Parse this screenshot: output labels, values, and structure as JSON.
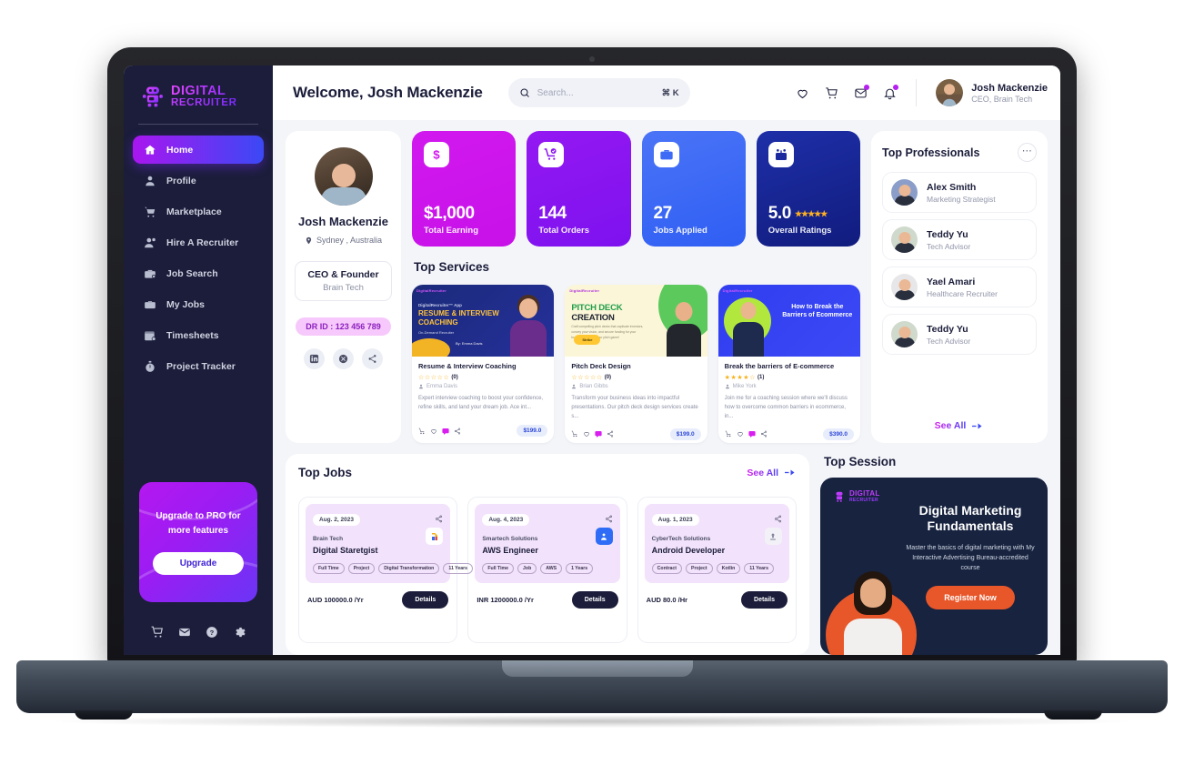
{
  "brand": {
    "line1": "DIGITAL",
    "line2": "RECRUITER",
    "icon": "robot-icon"
  },
  "sidebar": {
    "items": [
      {
        "label": "Home",
        "icon": "home-icon",
        "active": true
      },
      {
        "label": "Profile",
        "icon": "user-icon",
        "active": false
      },
      {
        "label": "Marketplace",
        "icon": "cart-icon",
        "active": false
      },
      {
        "label": "Hire A Recruiter",
        "icon": "user-plus-icon",
        "active": false
      },
      {
        "label": "Job Search",
        "icon": "briefcase-search-icon",
        "active": false
      },
      {
        "label": "My Jobs",
        "icon": "briefcase-icon",
        "active": false
      },
      {
        "label": "Timesheets",
        "icon": "calendar-clock-icon",
        "active": false
      },
      {
        "label": "Project Tracker",
        "icon": "stopwatch-icon",
        "active": false
      }
    ],
    "upgrade": {
      "text_pre": "Upgrade to ",
      "text_bold": "PRO",
      "text_post": " for more features",
      "button": "Upgrade"
    },
    "bottom_icons": [
      "cart-icon",
      "mail-icon",
      "help-icon",
      "settings-icon"
    ]
  },
  "header": {
    "welcome": "Welcome, Josh Mackenzie",
    "search": {
      "placeholder": "Search...",
      "value": "",
      "shortcut": "⌘ K",
      "icon": "search-icon"
    },
    "icons": [
      {
        "name": "heart-icon",
        "badge": false
      },
      {
        "name": "cart-icon",
        "badge": false
      },
      {
        "name": "mail-icon",
        "badge": true
      },
      {
        "name": "bell-icon",
        "badge": true
      }
    ],
    "user": {
      "name": "Josh Mackenzie",
      "role": "CEO, Brain Tech"
    }
  },
  "profile": {
    "name": "Josh Mackenzie",
    "location": "Sydney , Australia",
    "role_title": "CEO & Founder",
    "role_company": "Brain Tech",
    "dr_id": "DR ID : 123 456 789",
    "socials": [
      "linkedin-icon",
      "x-icon",
      "share-icon"
    ]
  },
  "stats": [
    {
      "value": "$1,000",
      "label": "Total Earning",
      "icon": "dollar-icon",
      "color": "#d119ef",
      "stars": ""
    },
    {
      "value": "144",
      "label": "Total Orders",
      "icon": "cart-check-icon",
      "color": "#8b15f0",
      "stars": ""
    },
    {
      "value": "27",
      "label": "Jobs Applied",
      "icon": "briefcase-icon",
      "color": "#3d6bf5",
      "stars": ""
    },
    {
      "value": "5.0",
      "label": "Overall Ratings",
      "icon": "badge-icon",
      "color": "#1a2a9e",
      "stars": "★★★★★"
    }
  ],
  "services": {
    "title": "Top Services",
    "items": [
      {
        "name": "Resume & Interview Coaching",
        "stars": "☆☆☆☆☆",
        "rating_count": "(0)",
        "author": "Emma Davis",
        "desc": "Expert interview coaching to boost your confidence, refine skills, and land your dream job. Ace int...",
        "price": "$199.0",
        "thumb": {
          "logo": "DigitalRecruiter",
          "kicker": "DigitalRecruiter™ App",
          "title": "RESUME & INTERVIEW COACHING",
          "sub": "On-Demand Recruiter",
          "by": "By: Emma Davis"
        }
      },
      {
        "name": "Pitch Deck Design",
        "stars": "☆☆☆☆☆",
        "rating_count": "(0)",
        "author": "Brian Gibbs",
        "desc": "Transform your business ideas into impactful presentations. Our pitch deck design services create s...",
        "price": "$199.0",
        "thumb": {
          "title_green": "PITCH DECK",
          "title_dark": "CREATION",
          "body": "Craft compelling pitch decks that captivate investors, convey your vision, and secure funding for your business. Elevate your pitch game!",
          "button": "Strike"
        }
      },
      {
        "name": "Break the barriers of E-commerce",
        "stars": "★★★★☆",
        "rating_count": "(1)",
        "author": "Mike York",
        "desc": "Join me for a coaching session where we'll discuss how to overcome common barriers in ecommerce, in...",
        "price": "$390.0",
        "thumb": {
          "headline": "How to Break the Barriers of Ecommerce"
        }
      }
    ],
    "footer_icons": [
      "cart-icon",
      "heart-icon",
      "chat-icon",
      "share-icon"
    ]
  },
  "professionals": {
    "title": "Top Professionals",
    "more_icon": "ellipsis-icon",
    "items": [
      {
        "name": "Alex Smith",
        "role": "Marketing Strategist",
        "avatar_bg": "#8b9ec9"
      },
      {
        "name": "Teddy Yu",
        "role": "Tech Advisor",
        "avatar_bg": "#cfd9cc"
      },
      {
        "name": "Yael Amari",
        "role": "Healthcare Recruiter",
        "avatar_bg": "#e7e7e9"
      },
      {
        "name": "Teddy Yu",
        "role": "Tech Advisor",
        "avatar_bg": "#cfd9cc"
      }
    ],
    "see_all": "See All"
  },
  "jobs": {
    "title": "Top Jobs",
    "see_all": "See All",
    "details_label": "Details",
    "items": [
      {
        "date": "Aug. 2, 2023",
        "company": "Brain Tech",
        "role": "Digital Staretgist",
        "tags": [
          "Full Time",
          "Project",
          "Digital Transformation",
          "11 Years"
        ],
        "salary": "AUD 100000.0 /Yr",
        "logo_style": "white",
        "logo_text": "Brain Tech"
      },
      {
        "date": "Aug. 4, 2023",
        "company": "Smartech Solutions",
        "role": "AWS Engineer",
        "tags": [
          "Full Time",
          "Job",
          "AWS",
          "1 Years"
        ],
        "salary": "INR 1200000.0 /Yr",
        "logo_style": "blue",
        "logo_text": ""
      },
      {
        "date": "Aug. 1, 2023",
        "company": "CyberTech Solutions",
        "role": "Android Developer",
        "tags": [
          "Contract",
          "Project",
          "Kotlin",
          "11 Years"
        ],
        "salary": "AUD 80.0 /Hr",
        "logo_style": "lite",
        "logo_text": ""
      }
    ]
  },
  "session": {
    "title": "Top Session",
    "banner": {
      "brand_l1": "DIGITAL",
      "brand_l2": "RECRUITER",
      "heading": "Digital Marketing Fundamentals",
      "body": "Master the basics of digital marketing with My Interactive Advertising Bureau-accredited course",
      "button": "Register Now"
    }
  }
}
